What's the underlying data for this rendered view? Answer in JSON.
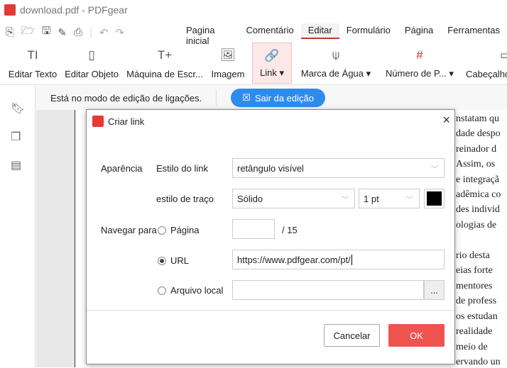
{
  "window": {
    "title": "download.pdf - PDFgear",
    "logo_text": "PDF"
  },
  "menu": [
    "Pagina inicial",
    "Comentário",
    "Editar",
    "Formulário",
    "Página",
    "Ferramentas"
  ],
  "ribbon": [
    {
      "label": "Editar Texto",
      "icon": "TI"
    },
    {
      "label": "Editar Objeto",
      "icon": "▯"
    },
    {
      "label": "Máquina de Escr...",
      "icon": "T+"
    },
    {
      "label": "Imagem",
      "icon": "🖼"
    },
    {
      "label": "Link ▾",
      "icon": "🔗"
    },
    {
      "label": "Marca de Água ▾",
      "icon": "⍦"
    },
    {
      "label": "Número de P... ▾",
      "icon": "#"
    },
    {
      "label": "Cabeçalho",
      "icon": "▭"
    }
  ],
  "notice": {
    "text": "Está no modo de edição de ligações.",
    "exit_label": "Sair da edição"
  },
  "page_lines": [
    "nstatam qu",
    "dade despo",
    "reinador d",
    "Assim, os",
    "e integraçã",
    "adêmica co",
    "des individ",
    "ologias de",
    "rio desta",
    "eias forte",
    "mentores",
    "de profess",
    "os estudan",
    "realidade",
    "meio de",
    "ervando un"
  ],
  "dialog": {
    "title": "Criar link",
    "appearance_label": "Aparência",
    "link_style_label": "Estilo do link",
    "link_style_value": "retângulo visível",
    "stroke_label": "estilo de traço",
    "stroke_value": "Sólido",
    "width_value": "1 pt",
    "stroke_color": "#000000",
    "navigate_label": "Navegar para",
    "page_option": "Página",
    "page_value": "",
    "page_total": "/ 15",
    "url_option": "URL",
    "url_value": "https://www.pdfgear.com/pt/",
    "local_option": "Arquivo local",
    "local_value": "",
    "browse_label": "...",
    "cancel": "Cancelar",
    "ok": "OK",
    "ok_color": "#ef5350"
  }
}
